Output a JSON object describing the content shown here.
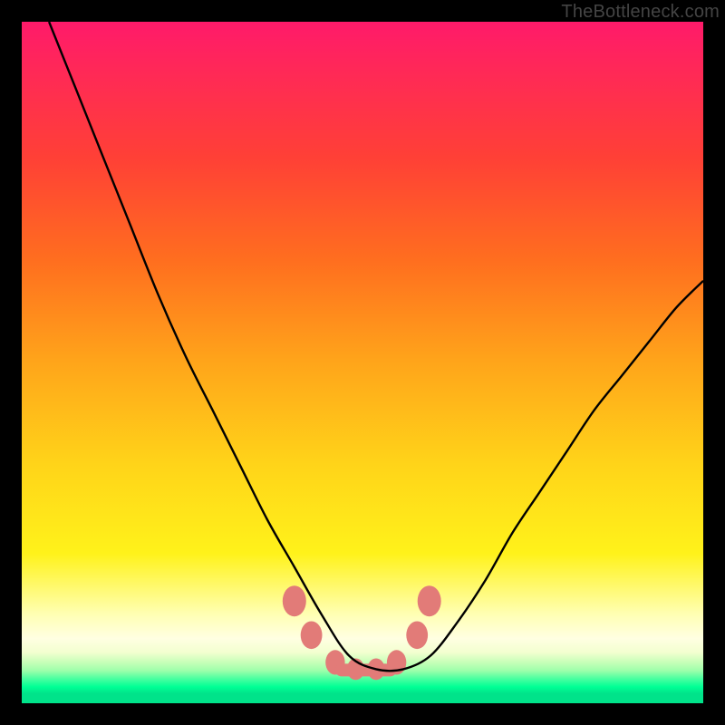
{
  "watermark": "TheBottleneck.com",
  "chart_data": {
    "type": "line",
    "title": "",
    "xlabel": "",
    "ylabel": "",
    "xlim": [
      0,
      100
    ],
    "ylim": [
      0,
      100
    ],
    "grid": false,
    "legend": false,
    "markers": {
      "shape": "blob",
      "color": "#e27b78",
      "x": [
        40.0,
        42.5,
        46.0,
        49.0,
        52.0,
        55.0,
        58.0,
        59.8
      ],
      "y": [
        15.0,
        10.0,
        6.0,
        5.0,
        5.0,
        6.0,
        10.0,
        15.0
      ]
    },
    "series": [
      {
        "name": "bottleneck-curve",
        "color": "#000000",
        "x": [
          4,
          8,
          12,
          16,
          20,
          24,
          28,
          32,
          36,
          40,
          44,
          48,
          52,
          56,
          60,
          64,
          68,
          72,
          76,
          80,
          84,
          88,
          92,
          96,
          100
        ],
        "y": [
          100,
          90,
          80,
          70,
          60,
          51,
          43,
          35,
          27,
          20,
          13,
          7,
          5,
          5,
          7,
          12,
          18,
          25,
          31,
          37,
          43,
          48,
          53,
          58,
          62
        ]
      }
    ],
    "background_gradient_stops": [
      {
        "pos": 0.0,
        "color": "#ff1a6a"
      },
      {
        "pos": 0.08,
        "color": "#ff2a55"
      },
      {
        "pos": 0.2,
        "color": "#ff4036"
      },
      {
        "pos": 0.35,
        "color": "#ff6e1f"
      },
      {
        "pos": 0.5,
        "color": "#ffa51a"
      },
      {
        "pos": 0.65,
        "color": "#ffd419"
      },
      {
        "pos": 0.78,
        "color": "#fff21a"
      },
      {
        "pos": 0.87,
        "color": "#ffffb4"
      },
      {
        "pos": 0.905,
        "color": "#ffffe2"
      },
      {
        "pos": 0.925,
        "color": "#f3ffd0"
      },
      {
        "pos": 0.94,
        "color": "#c7ffb8"
      },
      {
        "pos": 0.952,
        "color": "#9effab"
      },
      {
        "pos": 0.964,
        "color": "#4affa0"
      },
      {
        "pos": 0.976,
        "color": "#00ff95"
      },
      {
        "pos": 0.986,
        "color": "#00e38a"
      },
      {
        "pos": 1.0,
        "color": "#00e38a"
      }
    ]
  }
}
